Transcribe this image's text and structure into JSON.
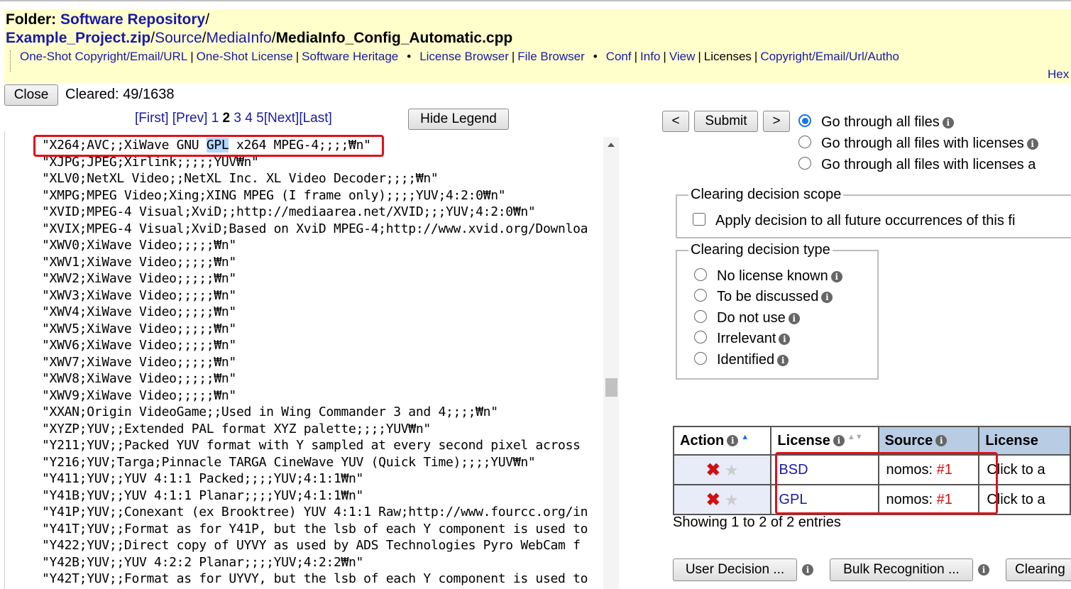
{
  "header": {
    "folder_label": "Folder:",
    "path_root": "Software Repository",
    "path_sep1": "/",
    "path_zip": "Example_Project.zip",
    "path_sep2": "/",
    "path_source": "Source",
    "path_sep3": "/",
    "path_mediainfo": "MediaInfo",
    "path_sep4": "/",
    "filename": "MediaInfo_Config_Automatic.cpp"
  },
  "nav": {
    "oneshot_copyright": "One-Shot Copyright/Email/URL",
    "oneshot_license": "One-Shot License",
    "software_heritage": "Software Heritage",
    "license_browser": "License Browser",
    "file_browser": "File Browser",
    "conf": "Conf",
    "info": "Info",
    "view": "View",
    "licenses": "Licenses",
    "copyright_author": "Copyright/Email/Url/Autho",
    "hex": "Hex",
    "pipe": "|",
    "bullet": "•"
  },
  "toolbar": {
    "close_label": "Close",
    "cleared_text": "Cleared: 49/1638"
  },
  "pager": {
    "first": "[First]",
    "prev": "[Prev]",
    "pages": [
      "1",
      "2",
      "3",
      "4",
      "5"
    ],
    "current": "2",
    "next": "[Next]",
    "last": "[Last]",
    "hide_legend": "Hide Legend"
  },
  "code": {
    "line0_pre": "\"X264;AVC;;XiWave GNU ",
    "line0_hl": "GPL",
    "line0_post": " x264 MPEG-4;;;;₩n\"",
    "lines": [
      "\"XJPG;JPEG;Xirlink;;;;;YUV₩n\"",
      "\"XLV0;NetXL Video;;NetXL Inc. XL Video Decoder;;;;₩n\"",
      "\"XMPG;MPEG Video;Xing;XING MPEG (I frame only);;;;YUV;4:2:0₩n\"",
      "\"XVID;MPEG-4 Visual;XviD;;http://mediaarea.net/XVID;;;YUV;4:2:0₩n\"",
      "\"XVIX;MPEG-4 Visual;XviD;Based on XviD MPEG-4;http://www.xvid.org/Downloa",
      "\"XWV0;XiWave Video;;;;;₩n\"",
      "\"XWV1;XiWave Video;;;;;₩n\"",
      "\"XWV2;XiWave Video;;;;;₩n\"",
      "\"XWV3;XiWave Video;;;;;₩n\"",
      "\"XWV4;XiWave Video;;;;;₩n\"",
      "\"XWV5;XiWave Video;;;;;₩n\"",
      "\"XWV6;XiWave Video;;;;;₩n\"",
      "\"XWV7;XiWave Video;;;;;₩n\"",
      "\"XWV8;XiWave Video;;;;;₩n\"",
      "\"XWV9;XiWave Video;;;;;₩n\"",
      "\"XXAN;Origin VideoGame;;Used in Wing Commander 3 and 4;;;;₩n\"",
      "\"XYZP;YUV;;Extended PAL format XYZ palette;;;;YUV₩n\"",
      "\"Y211;YUV;;Packed YUV format with Y sampled at every second pixel across",
      "\"Y216;YUV;Targa;Pinnacle TARGA CineWave YUV (Quick Time);;;;YUV₩n\"",
      "\"Y411;YUV;;YUV 4:1:1 Packed;;;;YUV;4:1:1₩n\"",
      "\"Y41B;YUV;;YUV 4:1:1 Planar;;;;YUV;4:1:1₩n\"",
      "\"Y41P;YUV;;Conexant (ex Brooktree) YUV 4:1:1 Raw;http://www.fourcc.org/in",
      "\"Y41T;YUV;;Format as for Y41P, but the lsb of each Y component is used to",
      "\"Y422;YUV;;Direct copy of UYVY as used by ADS Technologies Pyro WebCam f",
      "\"Y42B;YUV;;YUV 4:2:2 Planar;;;;YUV;4:2:2₩n\"",
      "\"Y42T;YUV;;Format as for UYVY, but the lsb of each Y component is used to"
    ]
  },
  "decision": {
    "prev_btn": "<",
    "submit_btn": "Submit",
    "next_btn": ">",
    "goto_options": [
      "Go through all files",
      "Go through all files with licenses",
      "Go through all files with licenses a"
    ],
    "scope_legend": "Clearing decision scope",
    "scope_checkbox": "Apply decision to all future occurrences of this fi",
    "type_legend": "Clearing decision type",
    "type_options": [
      "No license known",
      "To be discussed",
      "Do not use",
      "Irrelevant",
      "Identified"
    ]
  },
  "license_table": {
    "headers": [
      "Action",
      "License",
      "Source",
      "License"
    ],
    "rows": [
      {
        "license": "BSD",
        "source_prefix": "nomos:",
        "source_link": "#1",
        "text": "Click to a"
      },
      {
        "license": "GPL",
        "source_prefix": "nomos:",
        "source_link": "#1",
        "text": "Click to a"
      }
    ],
    "footer": "Showing 1 to 2 of 2 entries"
  },
  "bottom_buttons": {
    "user_decision": "User Decision ...",
    "bulk_recognition": "Bulk Recognition ...",
    "clearing": "Clearing"
  },
  "icons": {
    "info": "i",
    "remove": "✖",
    "star": "★"
  }
}
